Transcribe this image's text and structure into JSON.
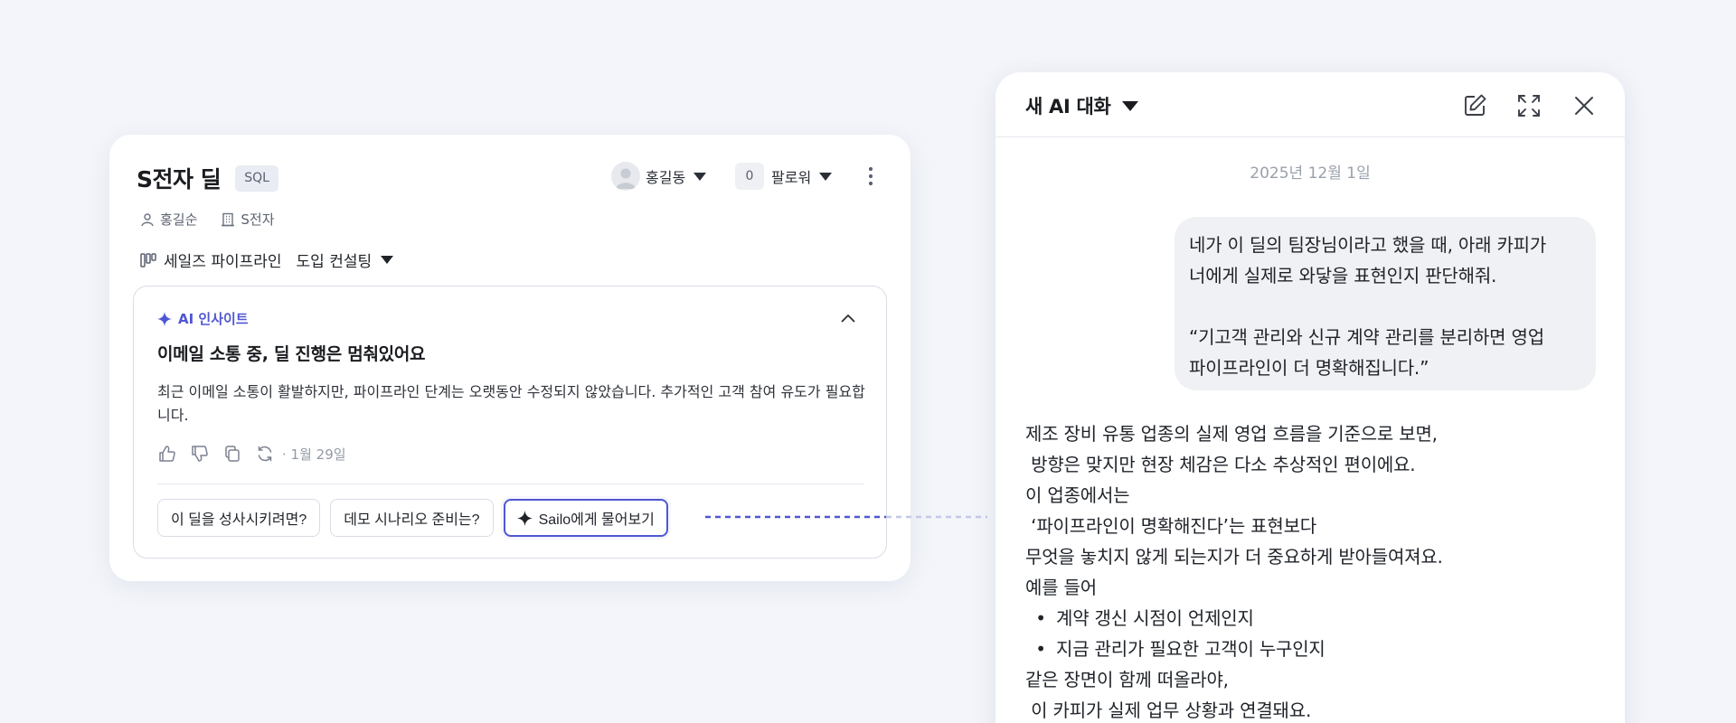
{
  "deal": {
    "title": "S전자 딜",
    "badge": "SQL",
    "owner": "홍길동",
    "follow_count": "0",
    "follow_label": "팔로워",
    "contact": "홍길순",
    "company": "S전자",
    "pipeline": "세일즈 파이프라인",
    "stage": "도입 컨설팅"
  },
  "insight": {
    "tag": "AI 인사이트",
    "heading": "이메일 소통 중, 딜 진행은 멈춰있어요",
    "body": "최근 이메일 소통이 활발하지만, 파이프라인 단계는 오랫동안 수정되지 않았습니다. 추가적인 고객 참여 유도가 필요합니다.",
    "date": "· 1월 29일",
    "chips": [
      "이 딜을 성사시키려면?",
      "데모 시나리오 준비는?"
    ],
    "ask_label": "Sailo에게 물어보기"
  },
  "chat": {
    "title": "새 AI 대화",
    "date": "2025년 12월 1일",
    "user_message_lines": [
      "네가 이 딜의 팀장님이라고 했을 때, 아래 카피가",
      "너에게 실제로 와닿을 표현인지 판단해줘.",
      "",
      "“기고객 관리와 신규 계약 관리를 분리하면 영업",
      "파이프라인이 더 명확해집니다.”"
    ],
    "ai_reply": {
      "lines_before": [
        "제조 장비 유통 업종의 실제 영업 흐름을 기준으로 보면,",
        " 방향은 맞지만 현장 체감은 다소 추상적인 편이에요.",
        "이 업종에서는",
        " ‘파이프라인이 명확해진다’는 표현보다",
        "무엇을 놓치지 않게 되는지가 더 중요하게 받아들여져요.",
        "예를 들어"
      ],
      "bullets": [
        "계약 갱신 시점이 언제인지",
        "지금 관리가 필요한 고객이 누구인지"
      ],
      "lines_after": [
        "같은 장면이 함께 떠올라야,",
        " 이 카피가 실제 업무 상황과 연결돼요."
      ]
    }
  },
  "colors": {
    "accent": "#4f56d3",
    "background": "#f3f5fa",
    "bubble": "#f0f1f4"
  },
  "icons": {
    "avatar": "user-avatar-icon",
    "caret": "caret-down-icon",
    "kebab": "kebab-menu-icon",
    "contact": "person-icon",
    "company": "building-icon",
    "pipeline": "pipeline-columns-icon",
    "insight": "sparkle-icon",
    "collapse": "chevron-up-icon",
    "actions": [
      "thumbs-up-icon",
      "thumbs-down-icon",
      "copy-icon",
      "refresh-icon"
    ],
    "chat_header": [
      "edit-icon",
      "expand-icon",
      "close-icon"
    ]
  }
}
